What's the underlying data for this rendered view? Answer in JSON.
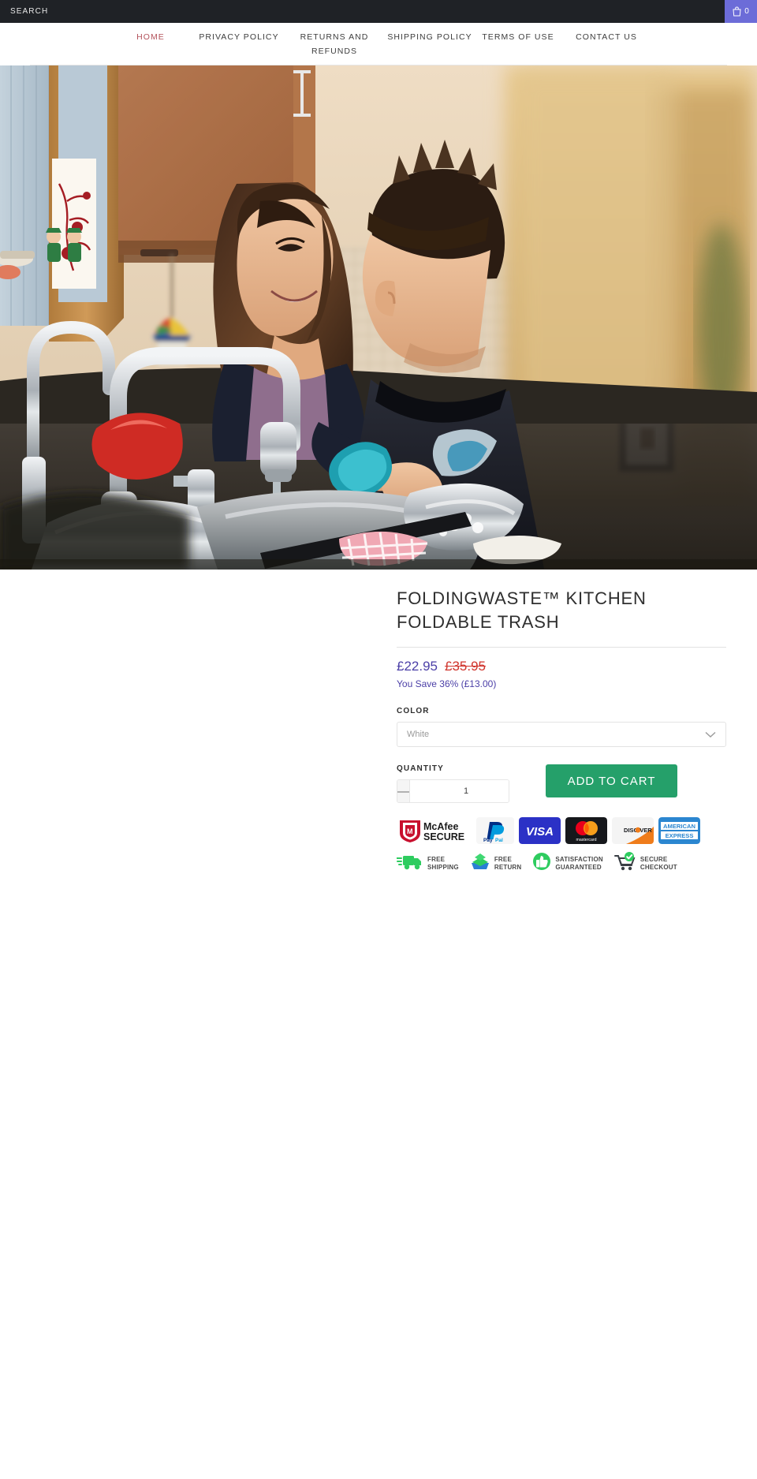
{
  "topbar": {
    "search_label": "SEARCH",
    "cart_icon": "shopping-bag-icon",
    "cart_count": "0",
    "bg_color": "#1f2226",
    "cart_bg_color": "#6c6cd8"
  },
  "nav": {
    "items": [
      {
        "label": "HOME",
        "active": true
      },
      {
        "label": "PRIVACY POLICY",
        "active": false
      },
      {
        "label": "RETURNS AND REFUNDS",
        "active": false
      },
      {
        "label": "SHIPPING POLICY",
        "active": false
      },
      {
        "label": "TERMS OF USE",
        "active": false
      },
      {
        "label": "CONTACT US",
        "active": false
      }
    ],
    "active_color": "#b3525b"
  },
  "hero": {
    "alt": "Mother and son washing dishes together at a kitchen sink"
  },
  "product": {
    "title": "FOLDINGWASTE™ KITCHEN FOLDABLE TRASH",
    "price": "£22.95",
    "compare_at_price": "£35.95",
    "savings": "You Save 36% (£13.00)",
    "price_color": "#4b3fa7",
    "compare_color": "#d0342c",
    "color_label": "COLOR",
    "color_selected": "White",
    "color_options": [
      "White"
    ],
    "quantity_label": "QUANTITY",
    "quantity_value": "1",
    "decrease_label": "—",
    "increase_label": "+",
    "add_to_cart_label": "ADD TO CART",
    "add_to_cart_color": "#25a06a"
  },
  "payment_badges": [
    {
      "name": "mcafee-secure-badge",
      "label": "McAfee SECURE"
    },
    {
      "name": "paypal-badge",
      "label": "PayPal"
    },
    {
      "name": "visa-badge",
      "label": "VISA"
    },
    {
      "name": "mastercard-badge",
      "label": "mastercard"
    },
    {
      "name": "discover-badge",
      "label": "DISCOVER"
    },
    {
      "name": "amex-badge",
      "label": "AMERICAN EXPRESS"
    }
  ],
  "trust_badges": [
    {
      "icon": "delivery-truck-icon",
      "line1": "FREE",
      "line2": "SHIPPING"
    },
    {
      "icon": "return-box-icon",
      "line1": "FREE",
      "line2": "RETURN"
    },
    {
      "icon": "thumbs-up-icon",
      "line1": "SATISFACTION",
      "line2": "GUARANTEED"
    },
    {
      "icon": "secure-cart-icon",
      "line1": "SECURE",
      "line2": "CHECKOUT"
    }
  ]
}
